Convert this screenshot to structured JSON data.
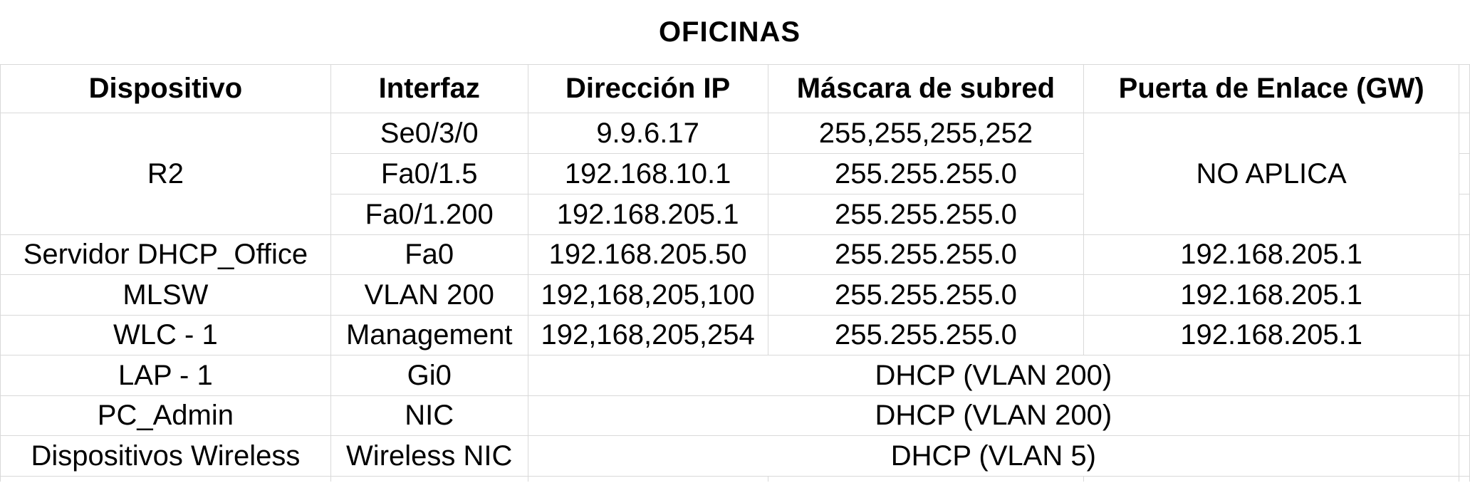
{
  "title": "OFICINAS",
  "headers": {
    "device": "Dispositivo",
    "interface": "Interfaz",
    "ip": "Dirección IP",
    "mask": "Máscara de subred",
    "gateway": "Puerta de Enlace (GW)"
  },
  "r2": {
    "device": "R2",
    "gateway": "NO APLICA",
    "interfaces": [
      {
        "interface": "Se0/3/0",
        "ip": "9.9.6.17",
        "mask": "255,255,255,252"
      },
      {
        "interface": "Fa0/1.5",
        "ip": "192.168.10.1",
        "mask": "255.255.255.0"
      },
      {
        "interface": "Fa0/1.200",
        "ip": "192.168.205.1",
        "mask": "255.255.255.0"
      }
    ]
  },
  "rows": [
    {
      "device": "Servidor DHCP_Office",
      "interface": "Fa0",
      "ip": "192.168.205.50",
      "mask": "255.255.255.0",
      "gateway": "192.168.205.1"
    },
    {
      "device": "MLSW",
      "interface": "VLAN 200",
      "ip": "192,168,205,100",
      "mask": "255.255.255.0",
      "gateway": "192.168.205.1"
    },
    {
      "device": "WLC - 1",
      "interface": "Management",
      "ip": "192,168,205,254",
      "mask": "255.255.255.0",
      "gateway": "192.168.205.1"
    }
  ],
  "dhcp_rows": [
    {
      "device": "LAP - 1",
      "interface": "Gi0",
      "addressing": "DHCP (VLAN 200)"
    },
    {
      "device": "PC_Admin",
      "interface": "NIC",
      "addressing": "DHCP (VLAN 200)"
    },
    {
      "device": "Dispositivos Wireless",
      "interface": "Wireless NIC",
      "addressing": "DHCP (VLAN 5)"
    }
  ]
}
